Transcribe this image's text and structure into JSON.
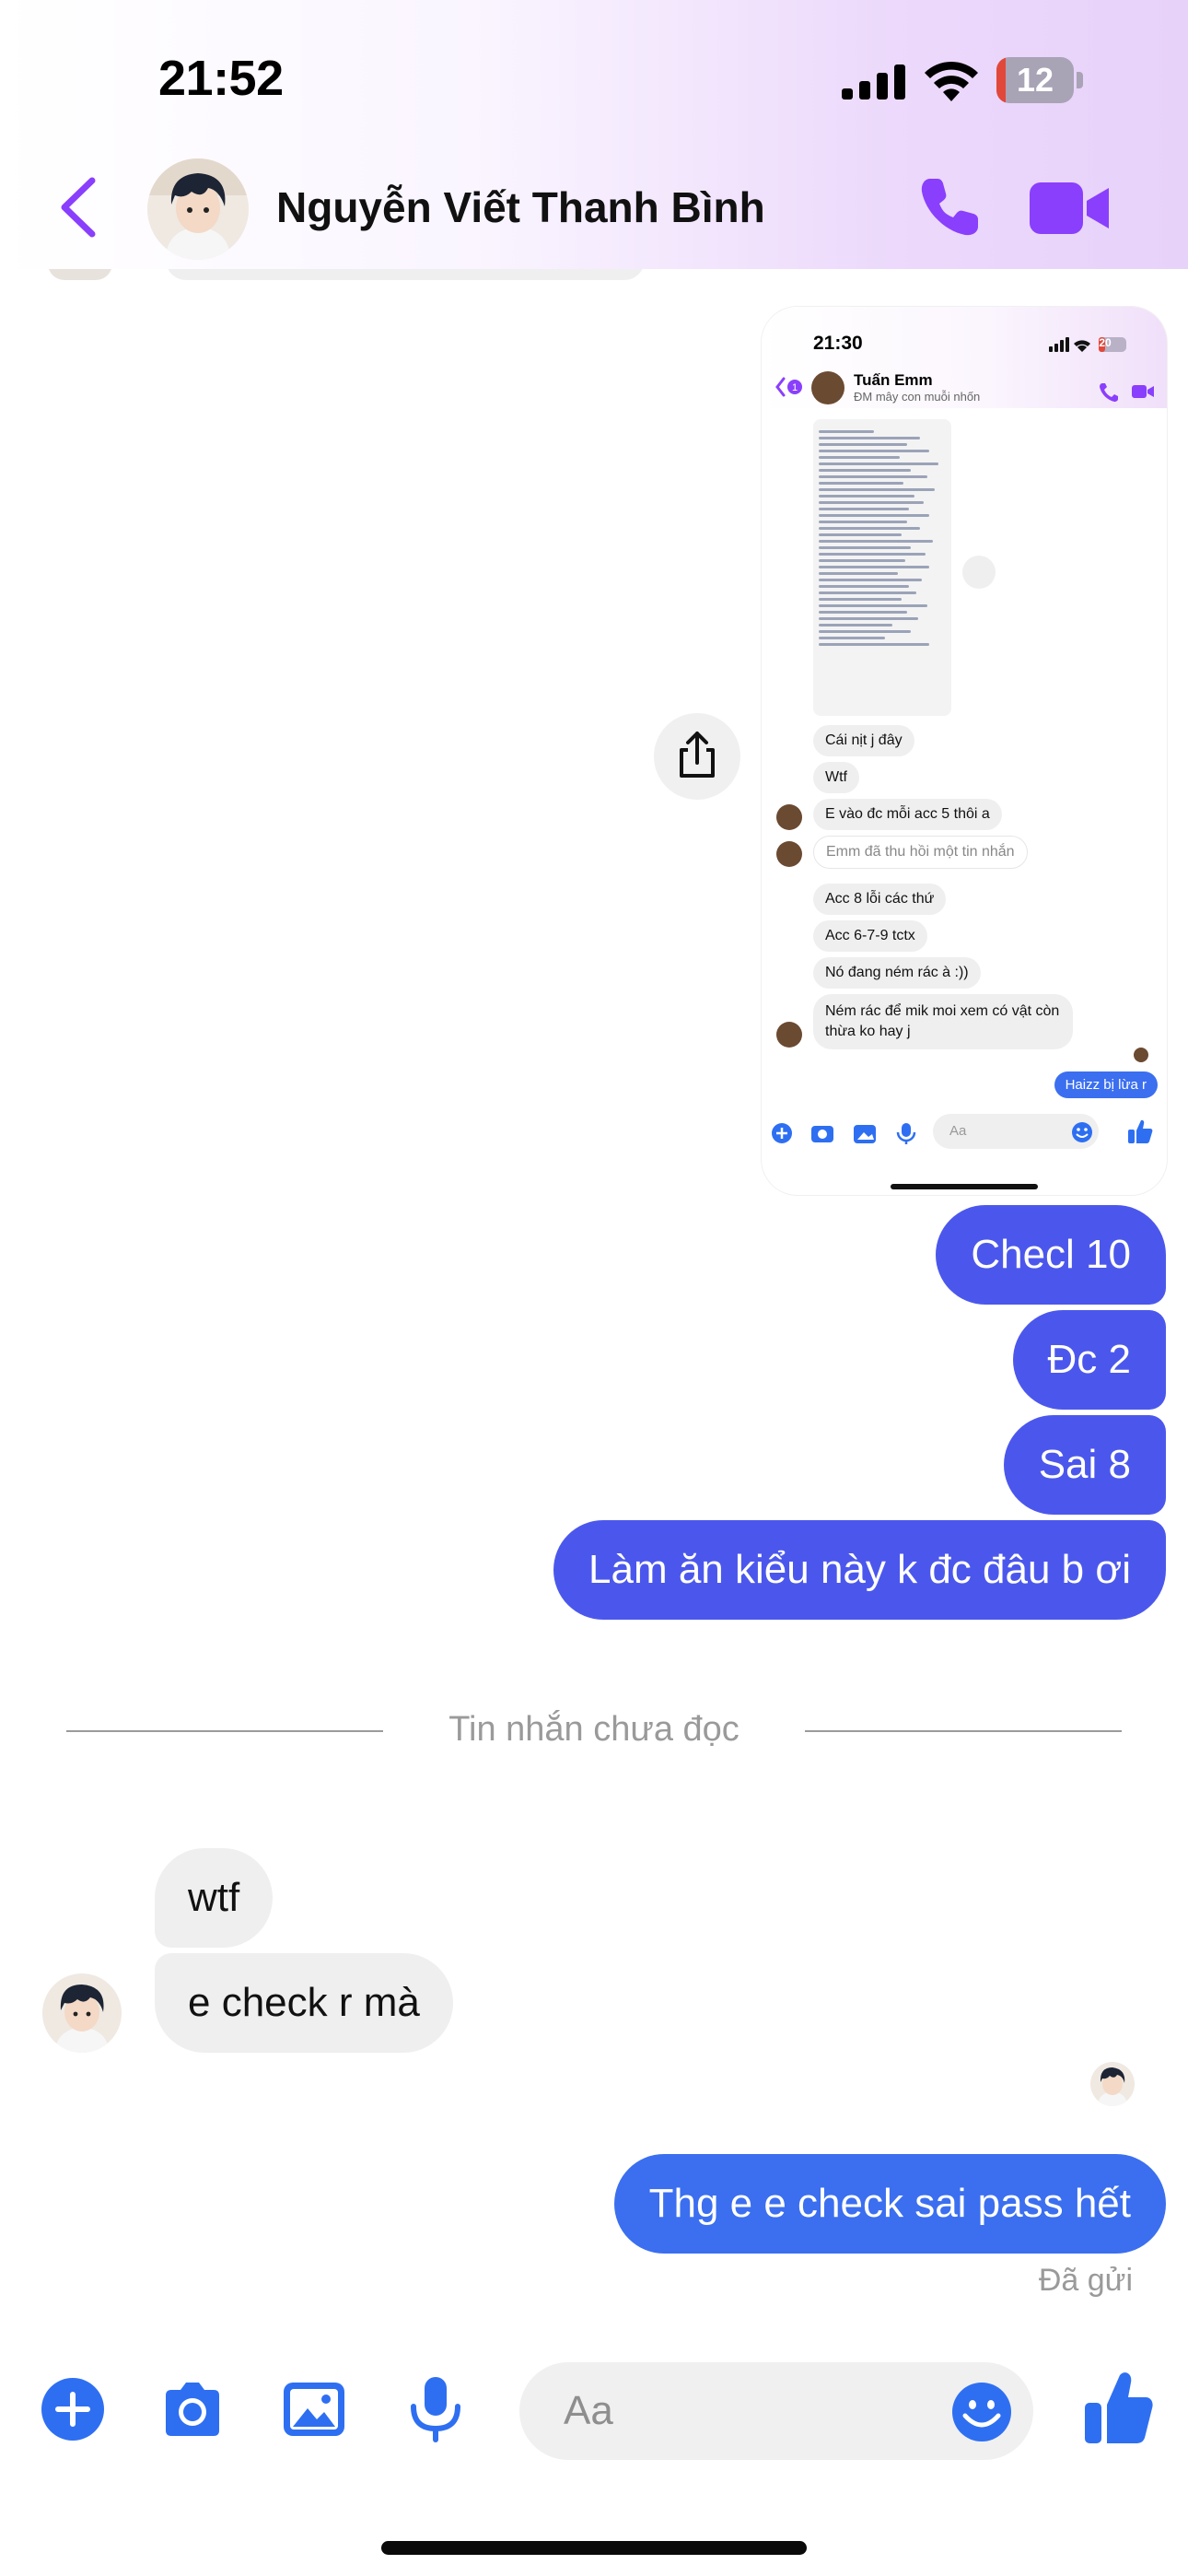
{
  "status_bar": {
    "time": "21:52",
    "battery": "12",
    "battery_level": 0.12
  },
  "header": {
    "contact_name": "Nguyễn Viết Thanh Bình"
  },
  "shared_screenshot": {
    "time": "21:30",
    "battery": "20",
    "contact_name": "Tuấn Emm",
    "contact_status": "ĐM mây con muỗi nhốn",
    "messages": [
      "Cái nịt j đây",
      "Wtf",
      "E vào đc mỗi acc 5 thôi a",
      "Emm đã thu hồi một tin nhắn",
      "Acc 8 lỗi các thứ",
      "Acc 6-7-9 tctx",
      "Nó đang ném rác à :))",
      "Ném rác để mik moi xem có vật còn thừa ko hay j",
      "Haizz bị lừa r"
    ],
    "input_placeholder": "Aa"
  },
  "messages_sent": [
    "Checl 10",
    "Đc 2",
    "Sai 8",
    "Làm ăn kiểu này k đc đâu b ơi"
  ],
  "unread_divider": "Tin nhắn chưa đọc",
  "messages_received": [
    "wtf",
    "e check r mà"
  ],
  "last_sent": "Thg e e check sai pass hết",
  "sent_status": "Đã gửi",
  "composer": {
    "placeholder": "Aa",
    "icons": [
      "plus-icon",
      "camera-icon",
      "image-icon",
      "microphone-icon",
      "emoji-icon",
      "thumbs-up-icon"
    ]
  },
  "colors": {
    "accent_purple": "#8a3ffc",
    "bubble_mine": "#4b57ec",
    "bubble_mine_last": "#3b6ff0",
    "icon_blue": "#2e6ff2"
  }
}
